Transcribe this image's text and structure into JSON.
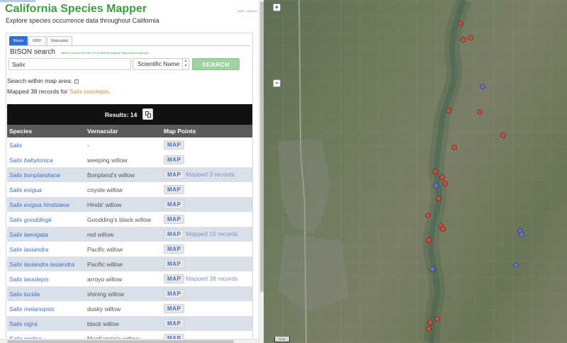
{
  "app": {
    "title": "California Species Mapper",
    "link_text": "GBIF | CalFlora",
    "subtitle": "Explore species occurrence data throughout California"
  },
  "tabs": [
    {
      "label": "Bison",
      "active": true
    },
    {
      "label": "GBIF",
      "active": false
    },
    {
      "label": "iNaturalist",
      "active": false
    }
  ],
  "search": {
    "title": "BISON search",
    "note": "search records from the USGS BISON program https://bison.usgs.gov",
    "value": "Salix",
    "select_value": "Scientific Name",
    "button_label": "SEARCH",
    "within_label": "Search within map area:",
    "within_checked": true,
    "mapped_prefix": "Mapped 38 records for ",
    "mapped_species": "Salix lasiolepis",
    "mapped_suffix": "."
  },
  "results": {
    "label": "Results: 14",
    "columns": [
      "Species",
      "Vernacular",
      "Map Points"
    ],
    "map_label": "MAP",
    "rows": [
      {
        "species": "Salix",
        "vernacular": "-",
        "mapped": ""
      },
      {
        "species": "Salix babylonica",
        "vernacular": "weeping willow",
        "mapped": ""
      },
      {
        "species": "Salix bonplandiana",
        "vernacular": "Bonpland's willow",
        "mapped": "Mapped 3 records"
      },
      {
        "species": "Salix exigua",
        "vernacular": "coyote willow",
        "mapped": ""
      },
      {
        "species": "Salix exigua hindsiana",
        "vernacular": "Hinds' willow",
        "mapped": ""
      },
      {
        "species": "Salix gooddingii",
        "vernacular": "Goodding's black willow",
        "mapped": ""
      },
      {
        "species": "Salix laevigata",
        "vernacular": "red willow",
        "mapped": "Mapped 15 records"
      },
      {
        "species": "Salix lasiandra",
        "vernacular": "Pacific willow",
        "mapped": ""
      },
      {
        "species": "Salix lasiandra lasiandra",
        "vernacular": "Pacific willow",
        "mapped": ""
      },
      {
        "species": "Salix lasiolepis",
        "vernacular": "arroyo willow",
        "mapped": "Mapped 38 records"
      },
      {
        "species": "Salix lucida",
        "vernacular": "shining willow",
        "mapped": ""
      },
      {
        "species": "Salix melanopsis",
        "vernacular": "dusky willow",
        "mapped": ""
      },
      {
        "species": "Salix nigra",
        "vernacular": "black willow",
        "mapped": ""
      },
      {
        "species": "Salix prolixa",
        "vernacular": "MacKenzie's willow",
        "mapped": ""
      }
    ]
  },
  "map": {
    "zoom_in": "+",
    "zoom_out": "−",
    "scale_label": "2 mi",
    "marker_colors": {
      "red": "#d9463b",
      "blue": "#5a73d6"
    }
  }
}
